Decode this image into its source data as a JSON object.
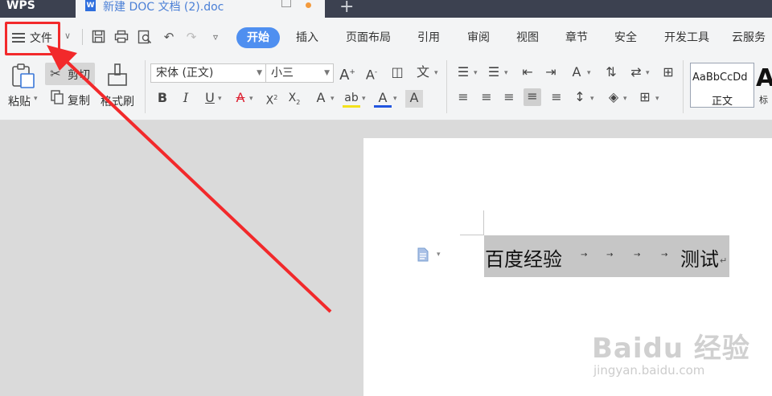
{
  "titlebar": {
    "app_name": "WPS",
    "doc_tab_title": "新建 DOC 文档 (2).doc",
    "new_tab": "+"
  },
  "tabs": {
    "file": "文件",
    "items": [
      "开始",
      "插入",
      "页面布局",
      "引用",
      "审阅",
      "视图",
      "章节",
      "安全",
      "开发工具",
      "云服务"
    ],
    "active": "开始"
  },
  "toolbar": {
    "paste": "粘贴",
    "cut": "剪切",
    "copy": "复制",
    "format_painter": "格式刷",
    "font_name": "宋体 (正文)",
    "font_size": "小三",
    "style_sample": "AaBbCcDd",
    "style_name": "正文",
    "style_next_sample": "A",
    "style_next_name": "标"
  },
  "document": {
    "text_left": "百度经验",
    "text_right": "测试",
    "tab_arrow": "→",
    "return_mark": "↵"
  },
  "watermark": {
    "brand": "Baidu 经验",
    "url": "jingyan.baidu.com"
  },
  "colors": {
    "titlebar": "#3c4150",
    "active_tab": "#4f8ff0",
    "annotation_red": "#f2292b"
  }
}
